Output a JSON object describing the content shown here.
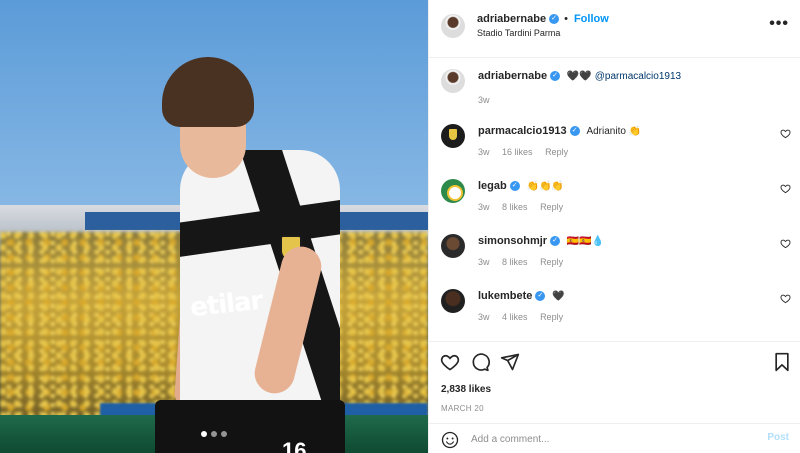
{
  "photo": {
    "sponsor_text": "etilar",
    "shorts_number": "16",
    "carousel": {
      "total": 3,
      "active": 1
    }
  },
  "header": {
    "username": "adriabernabe",
    "verified": true,
    "separator": "•",
    "follow_label": "Follow",
    "location": "Stadio Tardini Parma",
    "more_icon": "more-horizontal-icon"
  },
  "caption": {
    "username": "adriabernabe",
    "text": "🖤🖤",
    "mention": "@parmacalcio1913",
    "time": "3w"
  },
  "comments": [
    {
      "username": "parmacalcio1913",
      "text": "Adrianito 👏",
      "time": "3w",
      "likes": "16 likes",
      "reply": "Reply"
    },
    {
      "username": "legab",
      "text": "👏👏👏",
      "time": "3w",
      "likes": "8 likes",
      "reply": "Reply"
    },
    {
      "username": "simonsohmjr",
      "text": "🇪🇸🇪🇸💧",
      "time": "3w",
      "likes": "8 likes",
      "reply": "Reply"
    },
    {
      "username": "lukembete",
      "text": "🖤",
      "time": "3w",
      "likes": "4 likes",
      "reply": "Reply"
    }
  ],
  "actions": {
    "likes": "2,838 likes",
    "date": "MARCH 20",
    "icons": [
      "heart-icon",
      "comment-icon",
      "share-icon",
      "bookmark-icon"
    ]
  },
  "add_comment": {
    "placeholder": "Add a comment...",
    "post_label": "Post"
  },
  "colors": {
    "link": "#0095f6",
    "verified": "#3897f0",
    "muted": "#8e8e8e",
    "text": "#262626",
    "post_disabled": "#b2dffc"
  }
}
